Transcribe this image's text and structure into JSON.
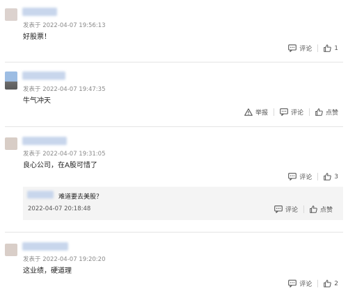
{
  "comments": [
    {
      "meta": "发表于 2022-04-07 19:56:13",
      "text": "好股票！",
      "report": "",
      "comment_label": "评论",
      "like_label": "1"
    },
    {
      "meta": "发表于 2022-04-07 19:47:35",
      "text": "牛气冲天",
      "report": "举报",
      "comment_label": "评论",
      "like_label": "点赞"
    },
    {
      "meta": "发表于 2022-04-07 19:31:05",
      "text": "良心公司，在A股可惜了",
      "report": "",
      "comment_label": "评论",
      "like_label": "3",
      "reply": {
        "text": "难道要去美股？",
        "time": "2022-04-07 20:18:48",
        "comment_label": "评论",
        "like_label": "点赞"
      }
    },
    {
      "meta": "发表于 2022-04-07 19:20:20",
      "text": "这业绩，硬道理",
      "report": "",
      "comment_label": "评论",
      "like_label": "2"
    }
  ],
  "icons": [
    "comment-icon",
    "thumbs-up-icon",
    "warning-icon"
  ]
}
